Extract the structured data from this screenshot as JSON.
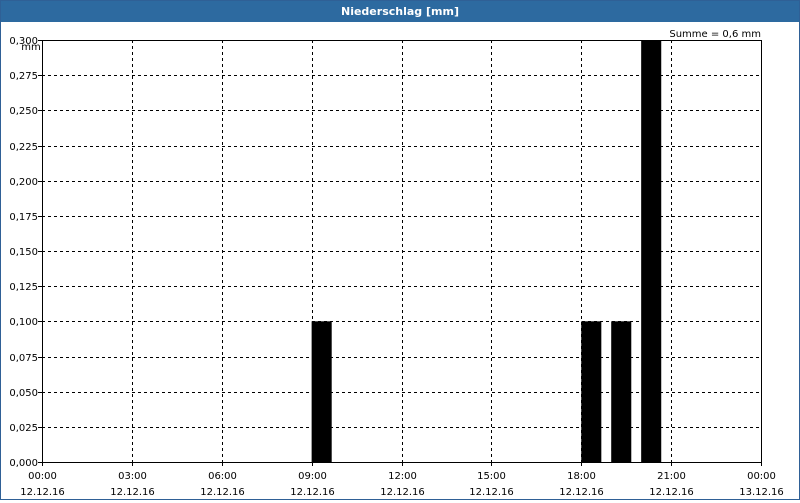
{
  "window": {
    "title": "Niederschlag [mm]"
  },
  "chart_data": {
    "type": "bar",
    "title": "Niederschlag [mm]",
    "unit_label": "mm",
    "summary": "Summe = 0,6 mm",
    "ylim": [
      0,
      0.3
    ],
    "y_ticks": [
      {
        "value": 0.0,
        "label": "0,000"
      },
      {
        "value": 0.025,
        "label": "0,025"
      },
      {
        "value": 0.05,
        "label": "0,050"
      },
      {
        "value": 0.075,
        "label": "0,075"
      },
      {
        "value": 0.1,
        "label": "0,100"
      },
      {
        "value": 0.125,
        "label": "0,125"
      },
      {
        "value": 0.15,
        "label": "0,150"
      },
      {
        "value": 0.175,
        "label": "0,175"
      },
      {
        "value": 0.2,
        "label": "0,200"
      },
      {
        "value": 0.225,
        "label": "0,225"
      },
      {
        "value": 0.25,
        "label": "0,250"
      },
      {
        "value": 0.275,
        "label": "0,275"
      },
      {
        "value": 0.3,
        "label": "0,300"
      }
    ],
    "xlim_hours": [
      0,
      24
    ],
    "x_ticks": [
      {
        "hour": 0,
        "time": "00:00",
        "date": "12.12.16"
      },
      {
        "hour": 3,
        "time": "03:00",
        "date": "12.12.16"
      },
      {
        "hour": 6,
        "time": "06:00",
        "date": "12.12.16"
      },
      {
        "hour": 9,
        "time": "09:00",
        "date": "12.12.16"
      },
      {
        "hour": 12,
        "time": "12:00",
        "date": "12.12.16"
      },
      {
        "hour": 15,
        "time": "15:00",
        "date": "12.12.16"
      },
      {
        "hour": 18,
        "time": "18:00",
        "date": "12.12.16"
      },
      {
        "hour": 21,
        "time": "21:00",
        "date": "12.12.16"
      },
      {
        "hour": 24,
        "time": "00:00",
        "date": "13.12.16"
      }
    ],
    "bars": [
      {
        "start_hour": 9.0,
        "end_hour": 9.67,
        "value": 0.1
      },
      {
        "start_hour": 18.0,
        "end_hour": 18.67,
        "value": 0.1
      },
      {
        "start_hour": 19.0,
        "end_hour": 19.67,
        "value": 0.1
      },
      {
        "start_hour": 20.0,
        "end_hour": 20.67,
        "value": 0.3
      }
    ],
    "grid": true,
    "legend": "none",
    "colors": {
      "bar": "#000000",
      "title_bar": "#2d6aa0",
      "grid": "#000000"
    }
  }
}
